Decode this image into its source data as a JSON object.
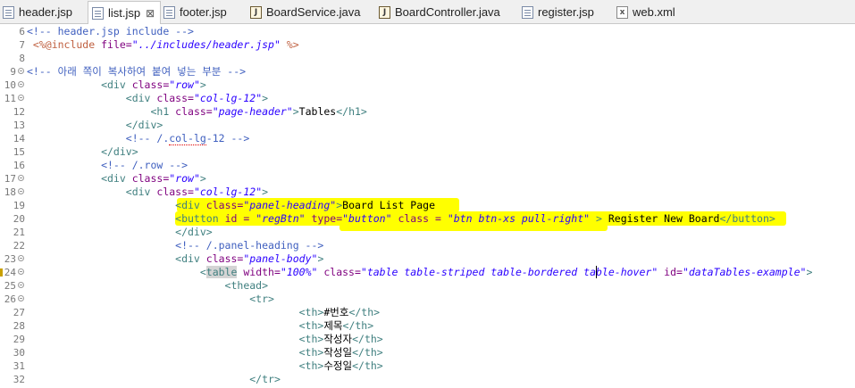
{
  "tabs": [
    {
      "label": "header.jsp",
      "type": "jsp",
      "active": false
    },
    {
      "label": "list.jsp",
      "type": "jsp",
      "active": true,
      "close": "⊠"
    },
    {
      "label": "footer.jsp",
      "type": "jsp",
      "active": false
    },
    {
      "label": "BoardService.java",
      "type": "java",
      "active": false
    },
    {
      "label": "BoardController.java",
      "type": "java",
      "active": false
    },
    {
      "label": "register.jsp",
      "type": "jsp",
      "active": false
    },
    {
      "label": "web.xml",
      "type": "xml",
      "active": false
    }
  ],
  "lines": [
    {
      "n": "6",
      "fold": false,
      "segs": [
        [
          "c",
          "<!-- header.jsp include -->"
        ]
      ]
    },
    {
      "n": "7",
      "fold": false,
      "segs": [
        [
          "j",
          " <%@include "
        ],
        [
          "a",
          "file="
        ],
        [
          "v",
          "\"../includes/header.jsp\""
        ],
        [
          "j",
          " %>"
        ]
      ]
    },
    {
      "n": "8",
      "fold": false,
      "segs": []
    },
    {
      "n": "9",
      "fold": true,
      "segs": [
        [
          "c",
          "<!-- 아래 쪽이 복사하여 붙여 넣는 부분 -->"
        ]
      ]
    },
    {
      "n": "10",
      "fold": true,
      "segs": [
        [
          "t",
          "            <div "
        ],
        [
          "a",
          "class="
        ],
        [
          "v",
          "\"row\""
        ],
        [
          "t",
          ">"
        ]
      ]
    },
    {
      "n": "11",
      "fold": true,
      "segs": [
        [
          "t",
          "                <div "
        ],
        [
          "a",
          "class="
        ],
        [
          "v",
          "\"col-lg-12\""
        ],
        [
          "t",
          ">"
        ]
      ]
    },
    {
      "n": "12",
      "fold": false,
      "segs": [
        [
          "t",
          "                    <h1 "
        ],
        [
          "a",
          "class="
        ],
        [
          "v",
          "\"page-header\""
        ],
        [
          "t",
          ">"
        ],
        [
          "plain",
          "Tables"
        ],
        [
          "t",
          "</h1>"
        ]
      ]
    },
    {
      "n": "13",
      "fold": false,
      "segs": [
        [
          "t",
          "                </div>"
        ]
      ]
    },
    {
      "n": "14",
      "fold": false,
      "segs": [
        [
          "c",
          "                <!-- /."
        ],
        [
          "csq",
          "col-lg"
        ],
        [
          "c",
          "-12 -->"
        ]
      ]
    },
    {
      "n": "15",
      "fold": false,
      "segs": [
        [
          "t",
          "            </div>"
        ]
      ]
    },
    {
      "n": "16",
      "fold": false,
      "segs": [
        [
          "c",
          "            <!-- /.row -->"
        ]
      ]
    },
    {
      "n": "17",
      "fold": true,
      "segs": [
        [
          "t",
          "            <div "
        ],
        [
          "a",
          "class="
        ],
        [
          "v",
          "\"row\""
        ],
        [
          "t",
          ">"
        ]
      ]
    },
    {
      "n": "18",
      "fold": true,
      "segs": [
        [
          "t",
          "                <div "
        ],
        [
          "a",
          "class="
        ],
        [
          "v",
          "\"col-lg-12\""
        ],
        [
          "t",
          ">"
        ]
      ]
    },
    {
      "n": "19",
      "fold": false,
      "segs": [
        [
          "t",
          "                        <div "
        ],
        [
          "a",
          "class="
        ],
        [
          "v",
          "\"panel-heading\""
        ],
        [
          "t",
          ">"
        ],
        [
          "plain",
          "Board List Page"
        ]
      ]
    },
    {
      "n": "20",
      "fold": false,
      "segs": [
        [
          "t",
          "                        <button "
        ],
        [
          "a",
          "id = "
        ],
        [
          "v",
          "\"regBtn\""
        ],
        [
          "a",
          " type="
        ],
        [
          "v",
          "\"button\""
        ],
        [
          "a",
          " class = "
        ],
        [
          "v",
          "\"btn btn-xs pull-right\""
        ],
        [
          "t",
          " > "
        ],
        [
          "plain",
          "Register New Board"
        ],
        [
          "t",
          "</button>"
        ]
      ]
    },
    {
      "n": "21",
      "fold": false,
      "segs": [
        [
          "t",
          "                        </div>"
        ]
      ]
    },
    {
      "n": "22",
      "fold": false,
      "segs": [
        [
          "c",
          "                        <!-- /.panel-heading -->"
        ]
      ]
    },
    {
      "n": "23",
      "fold": true,
      "segs": [
        [
          "t",
          "                        <div "
        ],
        [
          "a",
          "class="
        ],
        [
          "v",
          "\"panel-body\""
        ],
        [
          "t",
          ">"
        ]
      ]
    },
    {
      "n": "24",
      "fold": true,
      "segs": [
        [
          "t",
          "                            <"
        ],
        [
          "tbl",
          "table"
        ],
        [
          "a",
          " width="
        ],
        [
          "v",
          "\"100%\""
        ],
        [
          "a",
          " class="
        ],
        [
          "v",
          "\"table table-striped table-bordered table-hover\""
        ],
        [
          "a",
          " id="
        ],
        [
          "v",
          "\"dataTables-example\""
        ],
        [
          "t",
          ">"
        ]
      ]
    },
    {
      "n": "25",
      "fold": true,
      "segs": [
        [
          "t",
          "                                <thead>"
        ]
      ]
    },
    {
      "n": "26",
      "fold": true,
      "segs": [
        [
          "t",
          "                                    <tr>"
        ]
      ]
    },
    {
      "n": "27",
      "fold": false,
      "segs": [
        [
          "t",
          "                                            <th>"
        ],
        [
          "plain",
          "#번호"
        ],
        [
          "t",
          "</th>"
        ]
      ]
    },
    {
      "n": "28",
      "fold": false,
      "segs": [
        [
          "t",
          "                                            <th>"
        ],
        [
          "plain",
          "제목"
        ],
        [
          "t",
          "</th>"
        ]
      ]
    },
    {
      "n": "29",
      "fold": false,
      "segs": [
        [
          "t",
          "                                            <th>"
        ],
        [
          "plain",
          "작성자"
        ],
        [
          "t",
          "</th>"
        ]
      ]
    },
    {
      "n": "30",
      "fold": false,
      "segs": [
        [
          "t",
          "                                            <th>"
        ],
        [
          "plain",
          "작성일"
        ],
        [
          "t",
          "</th>"
        ]
      ]
    },
    {
      "n": "31",
      "fold": false,
      "segs": [
        [
          "t",
          "                                            <th>"
        ],
        [
          "plain",
          "수정일"
        ],
        [
          "t",
          "</th>"
        ]
      ]
    },
    {
      "n": "32",
      "fold": false,
      "segs": [
        [
          "t",
          "                                    </tr>"
        ]
      ]
    }
  ],
  "colors": {
    "highlight": "#ffff00",
    "tag": "#3f7f7f",
    "attr": "#7f007f",
    "value": "#2a00ff",
    "comment": "#3f5fbf"
  }
}
